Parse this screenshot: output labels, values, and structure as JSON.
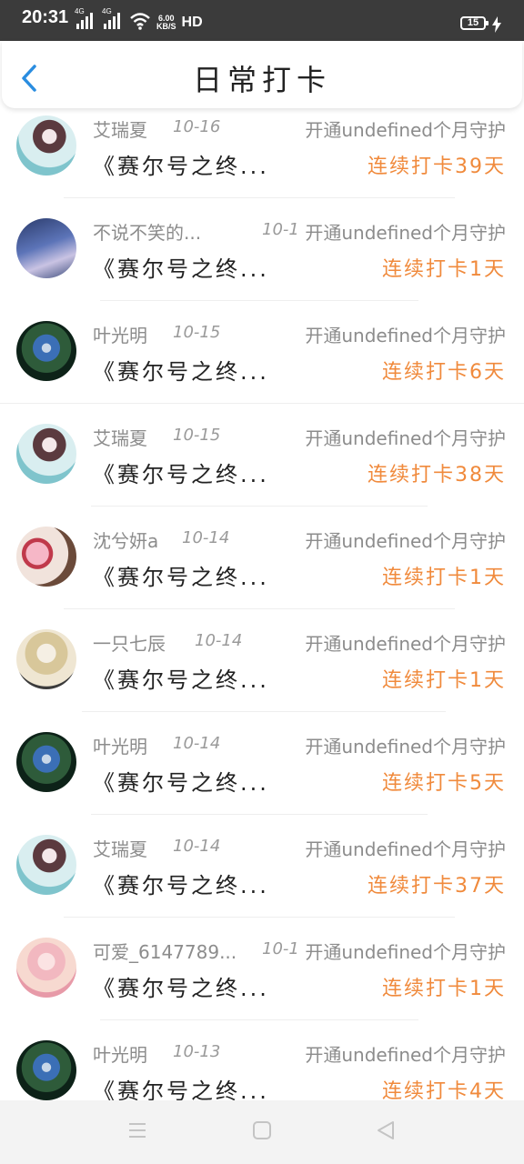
{
  "status_bar": {
    "time": "20:31",
    "network_1": "4G",
    "network_2": "4G",
    "speed_value": "6.00",
    "speed_unit": "KB/S",
    "hd": "HD",
    "battery": "15"
  },
  "header": {
    "title": "日常打卡",
    "back_icon": "chevron-left-icon"
  },
  "records": [
    {
      "name": "艾瑞夏",
      "date": "10-16",
      "guard": "开通undefined个月守护",
      "book": "《赛尔号之终...",
      "streak": "连续打卡39天",
      "avatar": "anime-girl-teal"
    },
    {
      "name": "不说不笑的...",
      "date": "10-1",
      "guard": "开通undefined个月守护",
      "book": "《赛尔号之终...",
      "streak": "连续打卡1天",
      "avatar": "group-poster"
    },
    {
      "name": "叶光明",
      "date": "10-15",
      "guard": "开通undefined个月守护",
      "book": "《赛尔号之终...",
      "streak": "连续打卡6天",
      "avatar": "mecha-robot"
    },
    {
      "name": "艾瑞夏",
      "date": "10-15",
      "guard": "开通undefined个月守护",
      "book": "《赛尔号之终...",
      "streak": "连续打卡38天",
      "avatar": "anime-girl-teal"
    },
    {
      "name": "沈兮妍a",
      "date": "10-14",
      "guard": "开通undefined个月守护",
      "book": "《赛尔号之终...",
      "streak": "连续打卡1天",
      "avatar": "girl-with-plush"
    },
    {
      "name": "一只七辰",
      "date": "10-14",
      "guard": "开通undefined个月守护",
      "book": "《赛尔号之终...",
      "streak": "连续打卡1天",
      "avatar": "sketch-anime"
    },
    {
      "name": "叶光明",
      "date": "10-14",
      "guard": "开通undefined个月守护",
      "book": "《赛尔号之终...",
      "streak": "连续打卡5天",
      "avatar": "mecha-robot"
    },
    {
      "name": "艾瑞夏",
      "date": "10-14",
      "guard": "开通undefined个月守护",
      "book": "《赛尔号之终...",
      "streak": "连续打卡37天",
      "avatar": "anime-girl-teal"
    },
    {
      "name": "可爱_6147789...",
      "date": "10-1",
      "guard": "开通undefined个月守护",
      "book": "《赛尔号之终...",
      "streak": "连续打卡1天",
      "avatar": "pink-girl"
    },
    {
      "name": "叶光明",
      "date": "10-13",
      "guard": "开通undefined个月守护",
      "book": "《赛尔号之终...",
      "streak": "连续打卡4天",
      "avatar": "mecha-robot"
    }
  ],
  "system_nav": {
    "menu_icon": "menu-icon",
    "home_icon": "home-square-icon",
    "back_icon": "back-triangle-icon"
  },
  "colors": {
    "streak": "#f08a3c",
    "accent": "#2a8de0",
    "status_bar": "#3b3b3b"
  }
}
